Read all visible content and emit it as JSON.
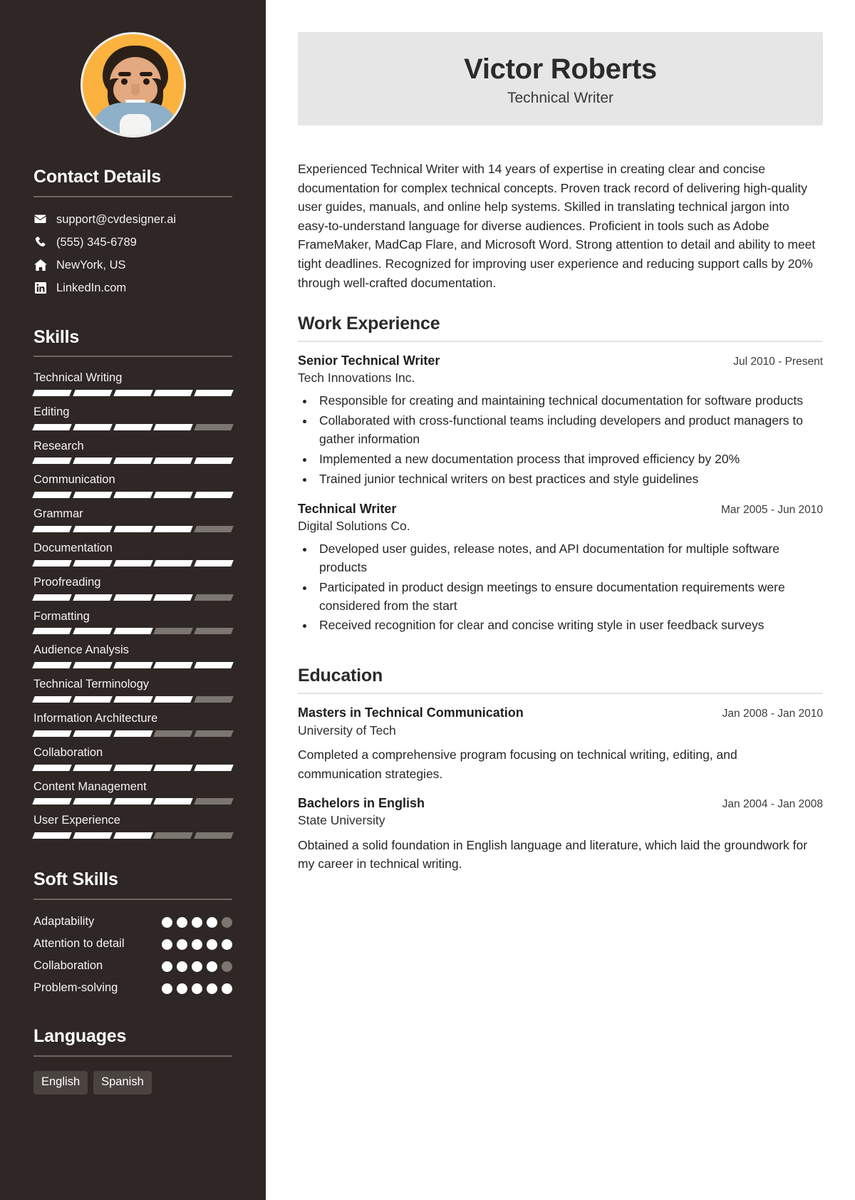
{
  "sidebar": {
    "avatar_alt": "profile-photo",
    "contact": {
      "heading": "Contact Details",
      "items": [
        {
          "icon": "envelope-icon",
          "text": "support@cvdesigner.ai"
        },
        {
          "icon": "phone-icon",
          "text": "(555) 345-6789"
        },
        {
          "icon": "home-icon",
          "text": "NewYork, US"
        },
        {
          "icon": "linkedin-icon",
          "text": "LinkedIn.com"
        }
      ]
    },
    "skills": {
      "heading": "Skills",
      "max_level": 5,
      "items": [
        {
          "name": "Technical Writing",
          "level": 5
        },
        {
          "name": "Editing",
          "level": 4
        },
        {
          "name": "Research",
          "level": 5
        },
        {
          "name": "Communication",
          "level": 5
        },
        {
          "name": "Grammar",
          "level": 4
        },
        {
          "name": "Documentation",
          "level": 5
        },
        {
          "name": "Proofreading",
          "level": 4
        },
        {
          "name": "Formatting",
          "level": 3
        },
        {
          "name": "Audience Analysis",
          "level": 5
        },
        {
          "name": "Technical Terminology",
          "level": 4
        },
        {
          "name": "Information Architecture",
          "level": 3
        },
        {
          "name": "Collaboration",
          "level": 5
        },
        {
          "name": "Content Management",
          "level": 4
        },
        {
          "name": "User Experience",
          "level": 3
        }
      ]
    },
    "soft_skills": {
      "heading": "Soft Skills",
      "max_level": 5,
      "items": [
        {
          "name": "Adaptability",
          "level": 4
        },
        {
          "name": "Attention to detail",
          "level": 5
        },
        {
          "name": "Collaboration",
          "level": 4
        },
        {
          "name": "Problem-solving",
          "level": 5
        }
      ]
    },
    "languages": {
      "heading": "Languages",
      "items": [
        "English",
        "Spanish"
      ]
    },
    "colors": {
      "background": "#2e2725",
      "filled": "#ffffff",
      "empty": "#7c7670",
      "tag_background": "#4a4340",
      "avatar_background": "#fcb23f"
    }
  },
  "main": {
    "header": {
      "name": "Victor Roberts",
      "title": "Technical Writer",
      "background": "#e6e6e6"
    },
    "summary": "Experienced Technical Writer with 14 years of expertise in creating clear and concise documentation for complex technical concepts. Proven track record of delivering high-quality user guides, manuals, and online help systems. Skilled in translating technical jargon into easy-to-understand language for diverse audiences. Proficient in tools such as Adobe FrameMaker, MadCap Flare, and Microsoft Word. Strong attention to detail and ability to meet tight deadlines. Recognized for improving user experience and reducing support calls by 20% through well-crafted documentation.",
    "work_experience": {
      "heading": "Work Experience",
      "entries": [
        {
          "role": "Senior Technical Writer",
          "organization": "Tech Innovations Inc.",
          "date": "Jul 2010 - Present",
          "bullets": [
            "Responsible for creating and maintaining technical documentation for software products",
            "Collaborated with cross-functional teams including developers and product managers to gather information",
            "Implemented a new documentation process that improved efficiency by 20%",
            "Trained junior technical writers on best practices and style guidelines"
          ]
        },
        {
          "role": "Technical Writer",
          "organization": "Digital Solutions Co.",
          "date": "Mar 2005 - Jun 2010",
          "bullets": [
            "Developed user guides, release notes, and API documentation for multiple software products",
            "Participated in product design meetings to ensure documentation requirements were considered from the start",
            "Received recognition for clear and concise writing style in user feedback surveys"
          ]
        }
      ]
    },
    "education": {
      "heading": "Education",
      "entries": [
        {
          "degree": "Masters in Technical Communication",
          "institution": "University of Tech",
          "date": "Jan 2008 - Jan 2010",
          "description": "Completed a comprehensive program focusing on technical writing, editing, and communication strategies."
        },
        {
          "degree": "Bachelors in English",
          "institution": "State University",
          "date": "Jan 2004 - Jan 2008",
          "description": "Obtained a solid foundation in English language and literature, which laid the groundwork for my career in technical writing."
        }
      ]
    }
  }
}
